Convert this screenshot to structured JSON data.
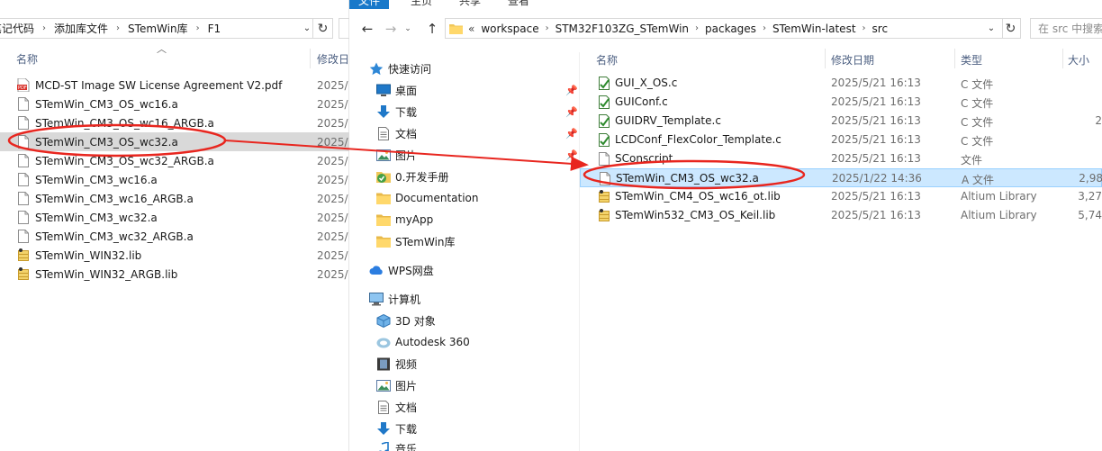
{
  "left": {
    "breadcrumb": [
      "笔记代码",
      "添加库文件",
      "STemWin库",
      "F1"
    ],
    "col_name": "名称",
    "col_date": "修改日",
    "files": [
      {
        "name": "MCD-ST Image SW License Agreement V2.pdf",
        "date": "2025/",
        "icon": "pdf-icon"
      },
      {
        "name": "STemWin_CM3_OS_wc16.a",
        "date": "2025/",
        "icon": "file-icon"
      },
      {
        "name": "STemWin_CM3_OS_wc16_ARGB.a",
        "date": "2025/",
        "icon": "file-icon"
      },
      {
        "name": "STemWin_CM3_OS_wc32.a",
        "date": "2025/",
        "icon": "file-icon"
      },
      {
        "name": "STemWin_CM3_OS_wc32_ARGB.a",
        "date": "2025/",
        "icon": "file-icon"
      },
      {
        "name": "STemWin_CM3_wc16.a",
        "date": "2025/",
        "icon": "file-icon"
      },
      {
        "name": "STemWin_CM3_wc16_ARGB.a",
        "date": "2025/",
        "icon": "file-icon"
      },
      {
        "name": "STemWin_CM3_wc32.a",
        "date": "2025/",
        "icon": "file-icon"
      },
      {
        "name": "STemWin_CM3_wc32_ARGB.a",
        "date": "2025/",
        "icon": "file-icon"
      },
      {
        "name": "STemWin_WIN32.lib",
        "date": "2025/",
        "icon": "lib-icon"
      },
      {
        "name": "STemWin_WIN32_ARGB.lib",
        "date": "2025/",
        "icon": "lib-icon"
      }
    ]
  },
  "right": {
    "ribbon_tabs": [
      "文件",
      "主页",
      "共享",
      "查看"
    ],
    "breadcrumb": [
      "workspace",
      "STM32F103ZG_STemWin",
      "packages",
      "STemWin-latest",
      "src"
    ],
    "chevron": "«",
    "search_placeholder": "在 src 中搜索",
    "nav": [
      {
        "label": "快速访问",
        "icon": "star-icon",
        "pinned": false
      },
      {
        "label": "桌面",
        "icon": "desktop-icon",
        "pinned": true
      },
      {
        "label": "下载",
        "icon": "download-icon",
        "pinned": true
      },
      {
        "label": "文档",
        "icon": "document-icon",
        "pinned": true
      },
      {
        "label": "图片",
        "icon": "picture-icon",
        "pinned": true
      },
      {
        "label": "0.开发手册",
        "icon": "synced-folder-icon",
        "pinned": false
      },
      {
        "label": "Documentation",
        "icon": "folder-icon",
        "pinned": false
      },
      {
        "label": "myApp",
        "icon": "folder-icon",
        "pinned": false
      },
      {
        "label": "STemWin库",
        "icon": "folder-icon",
        "pinned": false
      },
      {
        "label": "WPS网盘",
        "icon": "cloud-icon",
        "pinned": false
      },
      {
        "label": "计算机",
        "icon": "computer-icon",
        "pinned": false
      },
      {
        "label": "3D 对象",
        "icon": "cube-icon",
        "pinned": false
      },
      {
        "label": "Autodesk 360",
        "icon": "autodesk-icon",
        "pinned": false
      },
      {
        "label": "视频",
        "icon": "video-icon",
        "pinned": false
      },
      {
        "label": "图片",
        "icon": "picture-icon",
        "pinned": false
      },
      {
        "label": "文档",
        "icon": "document-icon",
        "pinned": false
      },
      {
        "label": "下载",
        "icon": "download-icon",
        "pinned": false
      },
      {
        "label": "音乐",
        "icon": "music-icon",
        "pinned": false
      }
    ],
    "col_name": "名称",
    "col_date": "修改日期",
    "col_type": "类型",
    "col_size": "大小",
    "files": [
      {
        "name": "GUI_X_OS.c",
        "date": "2025/5/21 16:13",
        "type": "C 文件",
        "size": "",
        "icon": "c-file-icon"
      },
      {
        "name": "GUIConf.c",
        "date": "2025/5/21 16:13",
        "type": "C 文件",
        "size": "",
        "icon": "c-file-icon"
      },
      {
        "name": "GUIDRV_Template.c",
        "date": "2025/5/21 16:13",
        "type": "C 文件",
        "size": "2",
        "icon": "c-file-icon"
      },
      {
        "name": "LCDConf_FlexColor_Template.c",
        "date": "2025/5/21 16:13",
        "type": "C 文件",
        "size": "",
        "icon": "c-file-icon"
      },
      {
        "name": "SConscript",
        "date": "2025/5/21 16:13",
        "type": "文件",
        "size": "",
        "icon": "file-icon"
      },
      {
        "name": "STemWin_CM3_OS_wc32.a",
        "date": "2025/1/22 14:36",
        "type": "A 文件",
        "size": "2,98",
        "icon": "file-icon"
      },
      {
        "name": "STemWin_CM4_OS_wc16_ot.lib",
        "date": "2025/5/21 16:13",
        "type": "Altium Library",
        "size": "3,27",
        "icon": "lib-icon"
      },
      {
        "name": "STemWin532_CM3_OS_Keil.lib",
        "date": "2025/5/21 16:13",
        "type": "Altium Library",
        "size": "5,74",
        "icon": "lib-icon"
      }
    ]
  },
  "colors": {
    "annotation_red": "#e8261f",
    "selection_blue": "#cce8ff",
    "selection_gray": "#d9d9d9",
    "ribbon_active": "#1979ca",
    "header_text": "#4d6082"
  }
}
